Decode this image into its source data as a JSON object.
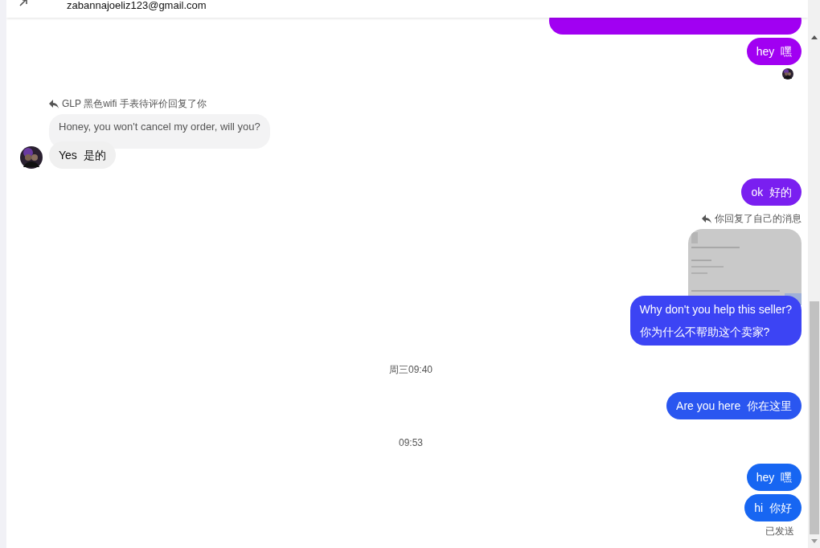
{
  "header": {
    "email": "zabannajoeliz123@gmail.com"
  },
  "groups": [
    {
      "kind": "outgoing",
      "clipped_bubble": {
        "color": "#a100f2"
      },
      "bubbles": [
        {
          "text": "hey  嘿",
          "color": "#a100f2"
        }
      ],
      "read_receipt": true
    },
    {
      "kind": "incoming",
      "reply_note": "GLP 黑色wifi 手表待评价回复了你",
      "quoted": "Honey, you won't cancel my order, will you?",
      "bubbles": [
        {
          "text": "Yes  是的"
        }
      ]
    },
    {
      "kind": "outgoing",
      "bubbles": [
        {
          "text": "ok  好的",
          "color": "#7a1ff0"
        }
      ]
    },
    {
      "kind": "outgoing",
      "reply_note": "你回复了自己的消息",
      "image": {
        "kind": "picture"
      },
      "bubbles": [
        {
          "lines": [
            "Why don't you help this seller?",
            "你为什么不帮助这个卖家?"
          ],
          "color": "#3c44f4"
        }
      ]
    },
    {
      "kind": "time",
      "text": "周三09:40"
    },
    {
      "kind": "outgoing",
      "bubbles": [
        {
          "text": "Are you here  你在这里",
          "color": "#2a56f0"
        }
      ]
    },
    {
      "kind": "time",
      "text": "09:53"
    },
    {
      "kind": "outgoing",
      "bubbles": [
        {
          "text": "hey  嘿",
          "color": "#1766f2"
        },
        {
          "text": "hi  你好",
          "color": "#1766f2"
        }
      ],
      "status": "已发送"
    }
  ]
}
